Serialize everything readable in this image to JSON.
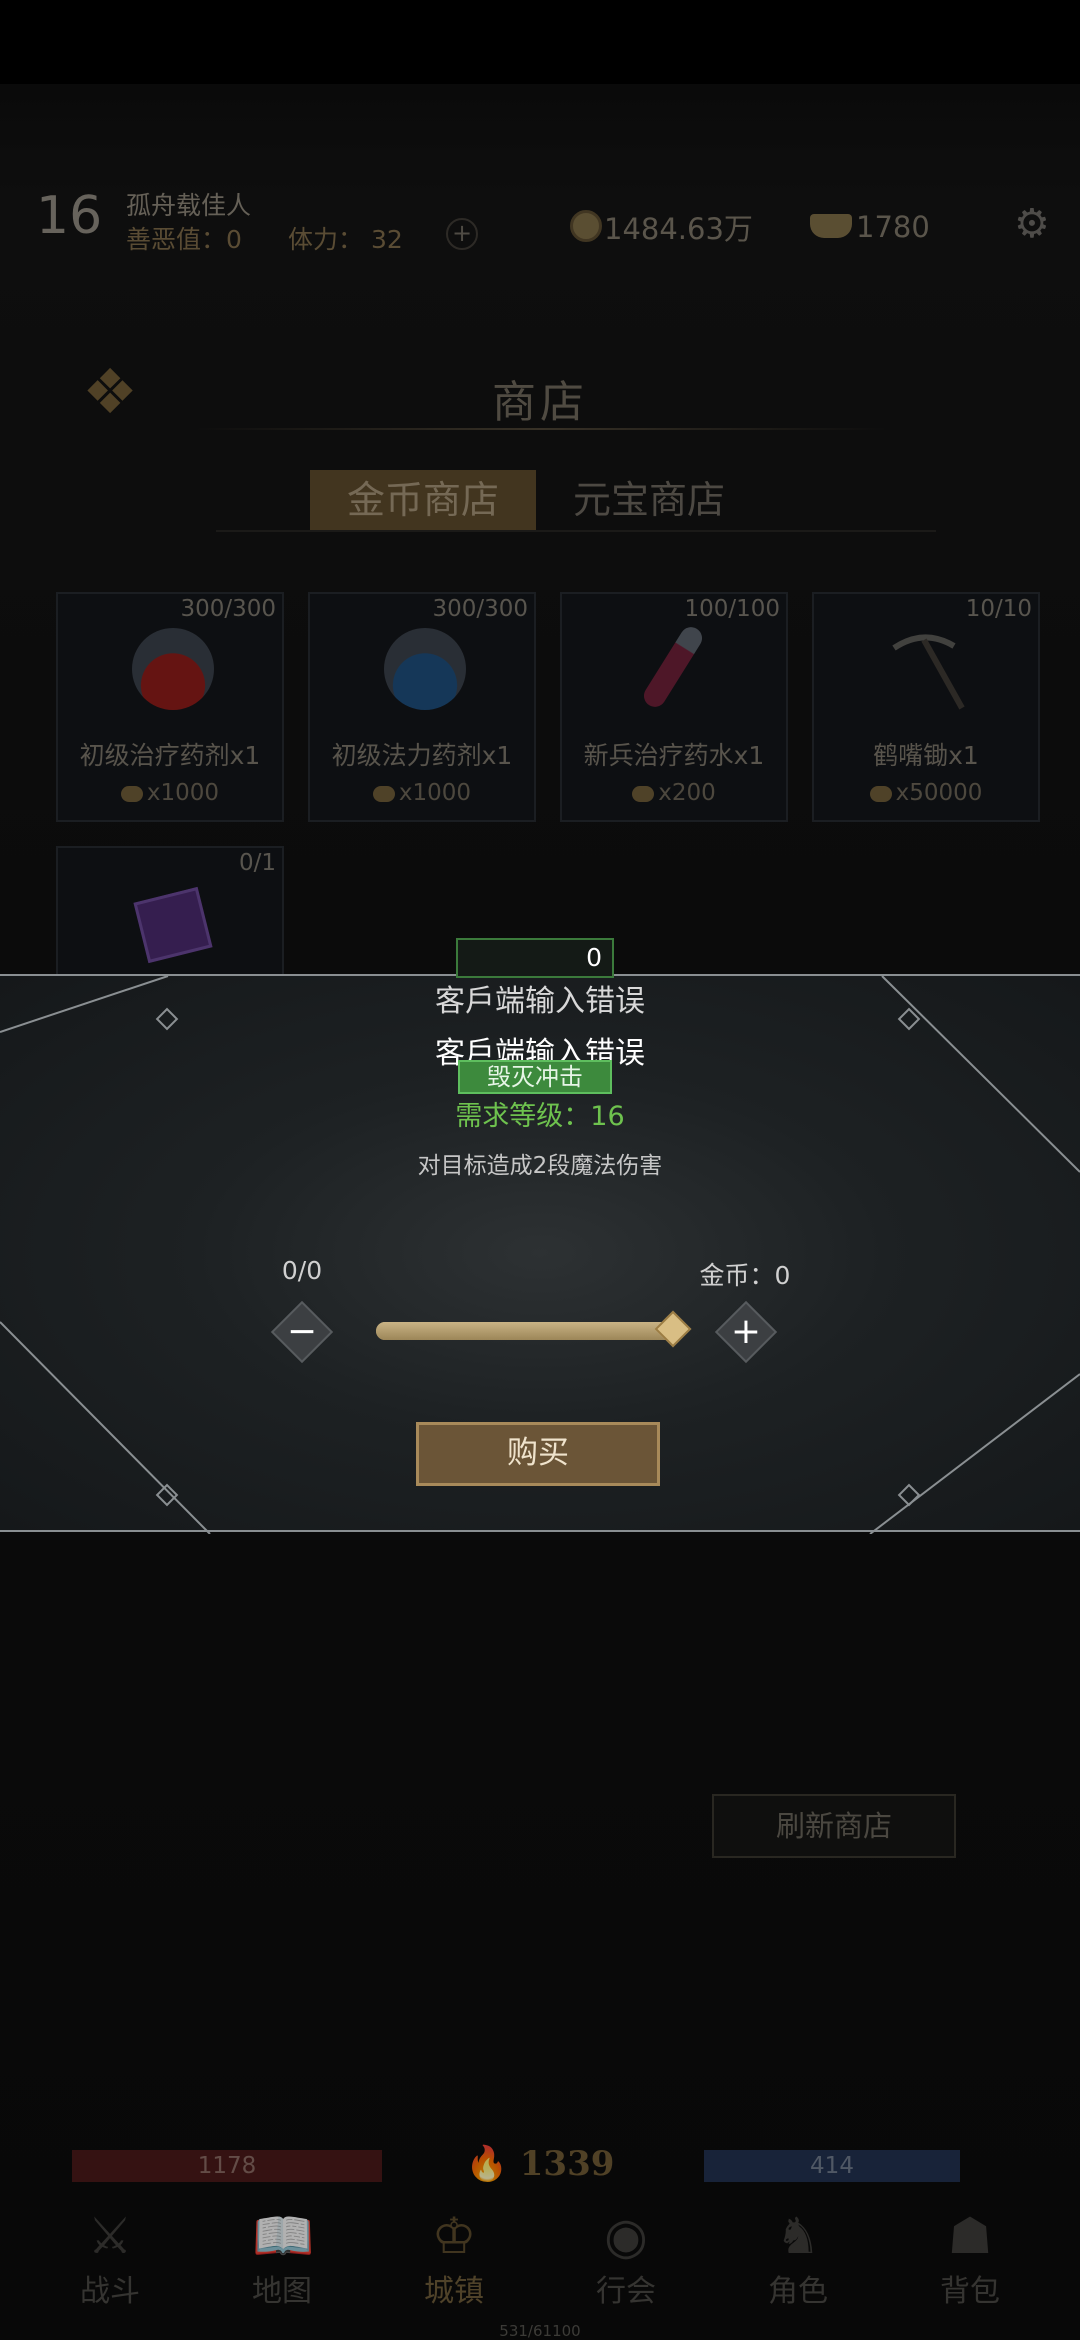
{
  "player": {
    "level": "16",
    "name": "孤舟载佳人",
    "karma": "善恶值：0",
    "stamina": "体力： 32",
    "stamina_add": "+",
    "coins": "1484.63万",
    "ingots": "1780"
  },
  "shop": {
    "title": "商店",
    "tabs": [
      {
        "label": "金币商店",
        "active": true
      },
      {
        "label": "元宝商店",
        "active": false
      }
    ],
    "items": [
      {
        "stock": "300/300",
        "name": "初级治疗药剂x1",
        "price": "x1000",
        "icon": "red-potion-icon"
      },
      {
        "stock": "300/300",
        "name": "初级法力药剂x1",
        "price": "x1000",
        "icon": "blue-potion-icon"
      },
      {
        "stock": "100/100",
        "name": "新兵治疗药水x1",
        "price": "x200",
        "icon": "vial-icon"
      },
      {
        "stock": "10/10",
        "name": "鹤嘴锄x1",
        "price": "x50000",
        "icon": "pickaxe-icon"
      },
      {
        "stock": "0/1",
        "name": "",
        "price": "",
        "icon": "spellbook-icon"
      }
    ],
    "refresh_label": "刷新商店"
  },
  "dialog": {
    "quantity_input": "0",
    "error_line_1": "客戶端输入错误",
    "error_line_2": "客戶端输入错误",
    "skill_badge": "毁灭冲击",
    "required_level": "需求等级：16",
    "description": "对目标造成2段魔法伤害",
    "quantity_count": "0/0",
    "gold_cost": "金币：0",
    "decrease": "−",
    "increase": "+",
    "slider_level": 1.0,
    "buy_label": "购买"
  },
  "status": {
    "hp": "1178",
    "power": "1339",
    "mp": "414"
  },
  "nav": [
    {
      "label": "战斗",
      "icon": "crossed-swords-icon",
      "active": false
    },
    {
      "label": "地图",
      "icon": "map-book-icon",
      "active": false
    },
    {
      "label": "城镇",
      "icon": "town-crest-icon",
      "active": true
    },
    {
      "label": "行会",
      "icon": "guild-eye-icon",
      "active": false
    },
    {
      "label": "角色",
      "icon": "character-icon",
      "active": false
    },
    {
      "label": "背包",
      "icon": "backpack-icon",
      "active": false
    }
  ],
  "exp": "531/61100",
  "colors": {
    "accent_gold": "#a88a5a",
    "error_green": "#6ec24e",
    "hp": "#4a1a1a",
    "mp": "#223150"
  }
}
